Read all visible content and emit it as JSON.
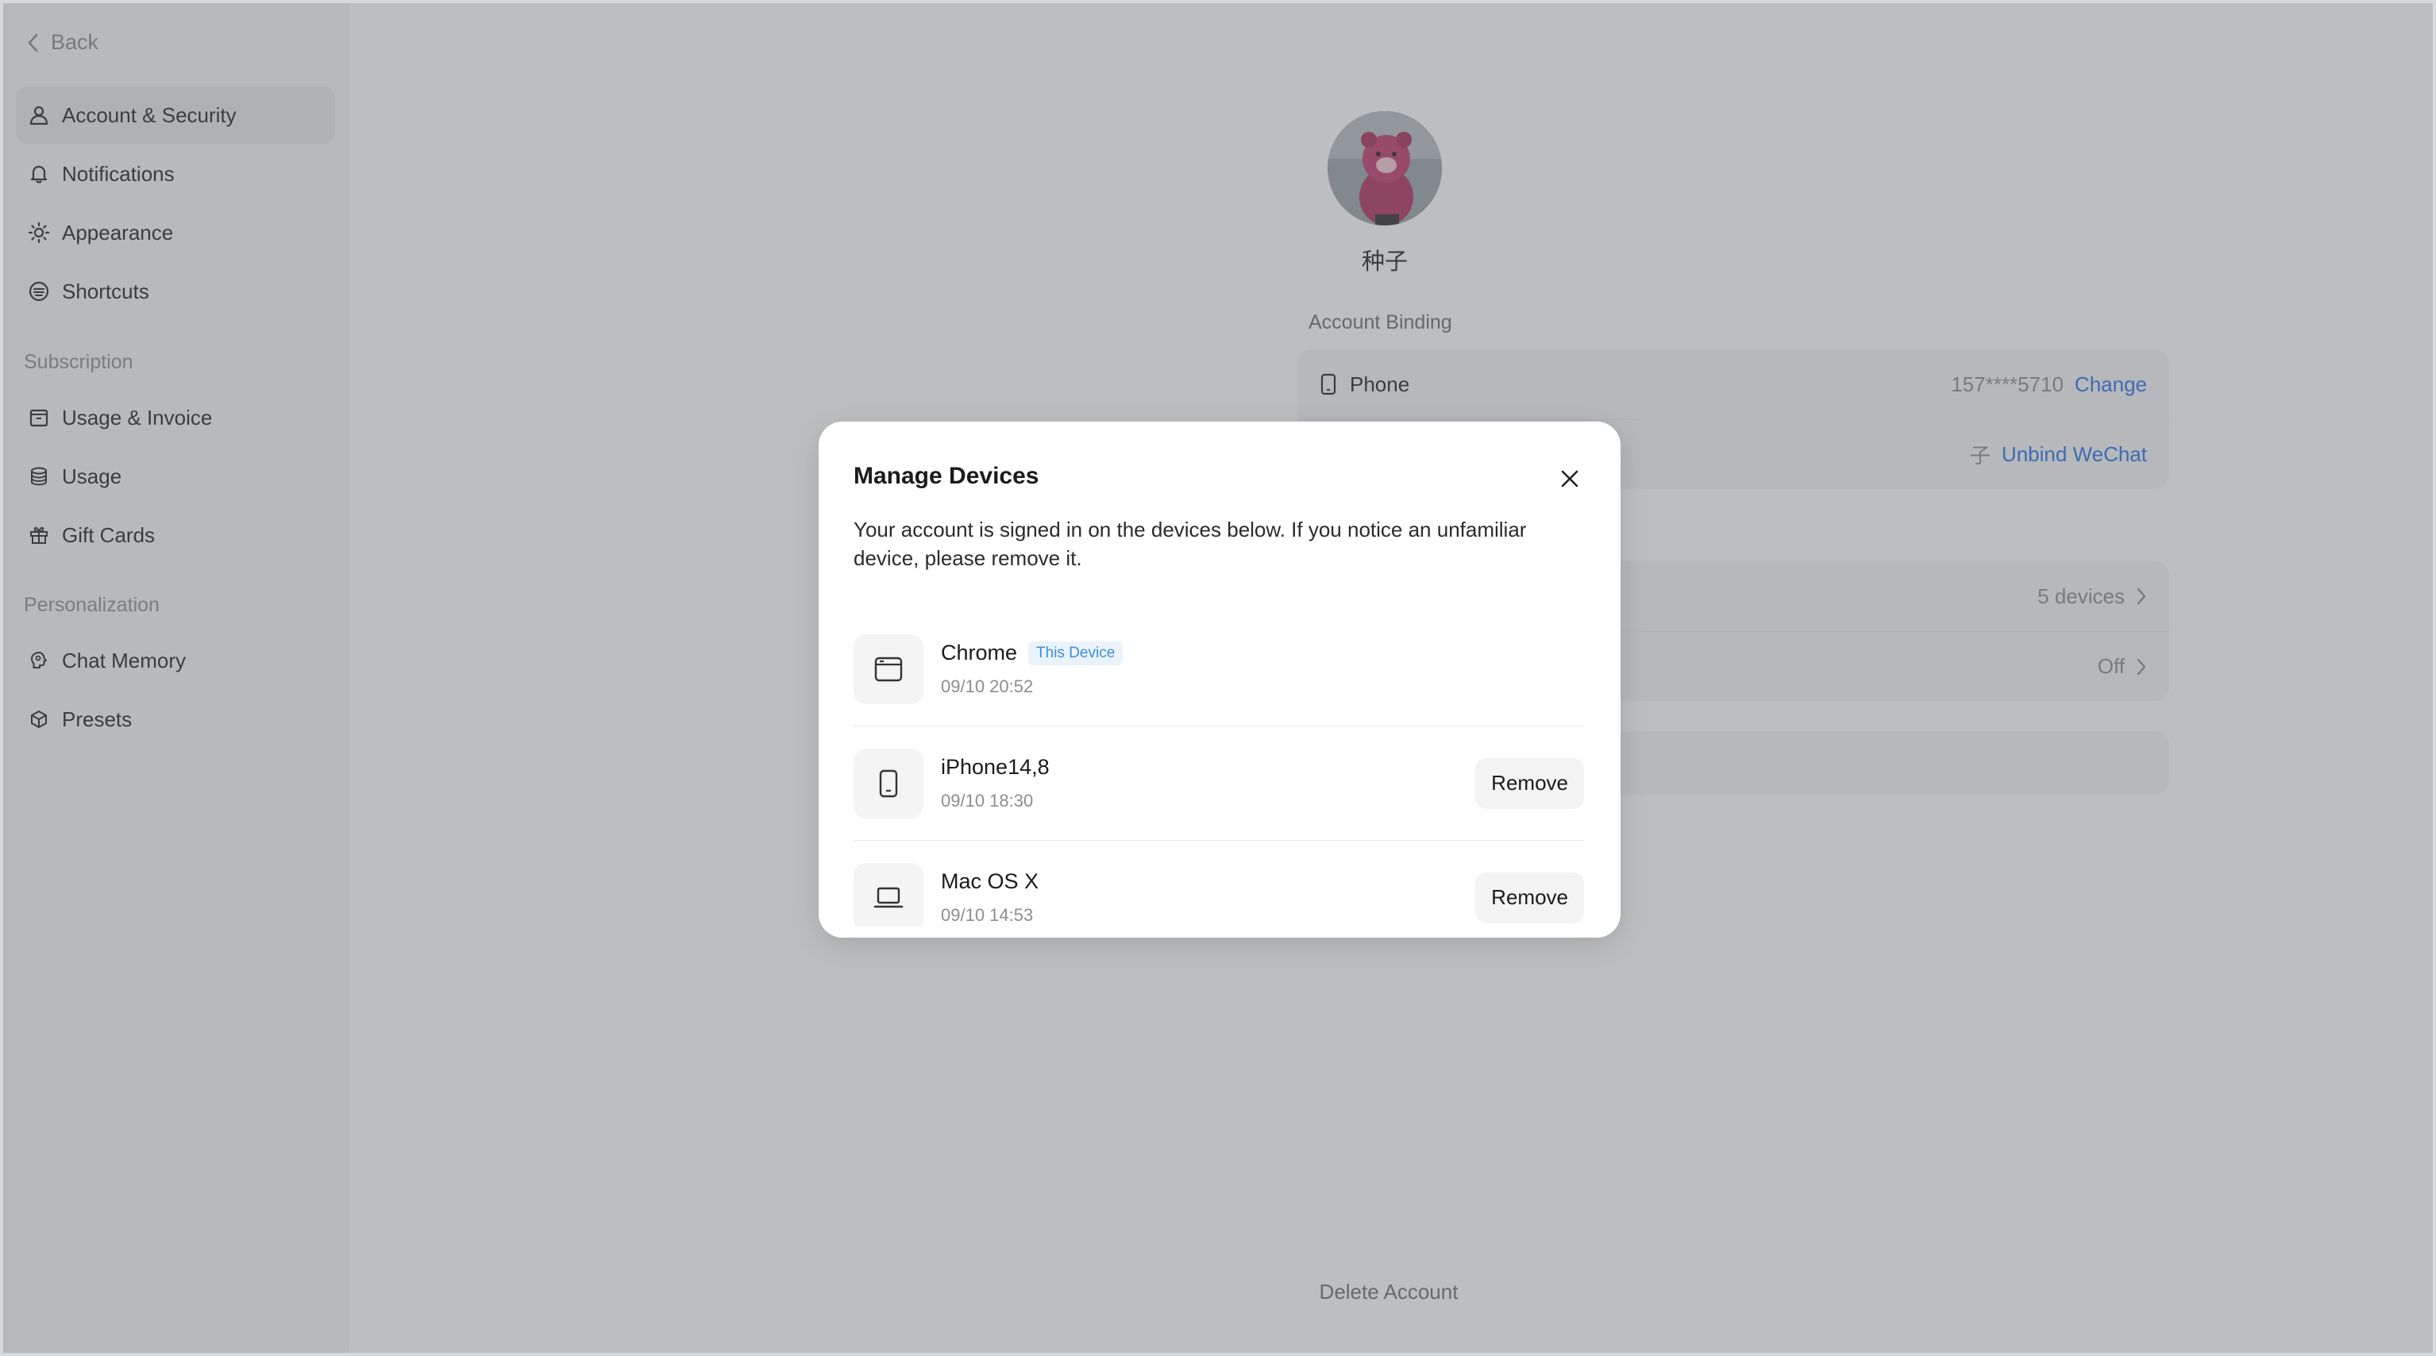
{
  "sidebar": {
    "back_label": "Back",
    "items": [
      {
        "label": "Account & Security",
        "icon": "user-icon"
      },
      {
        "label": "Notifications",
        "icon": "bell-icon"
      },
      {
        "label": "Appearance",
        "icon": "sun-icon"
      },
      {
        "label": "Shortcuts",
        "icon": "keyboard-icon"
      },
      {
        "label": "Usage & Invoice",
        "icon": "invoice-icon"
      },
      {
        "label": "Usage",
        "icon": "database-icon"
      },
      {
        "label": "Gift Cards",
        "icon": "gift-icon"
      },
      {
        "label": "Chat Memory",
        "icon": "brain-icon"
      },
      {
        "label": "Presets",
        "icon": "cube-icon"
      }
    ],
    "sections": {
      "subscription": "Subscription",
      "personalization": "Personalization"
    }
  },
  "profile": {
    "username": "种子"
  },
  "account_binding": {
    "label": "Account Binding",
    "phone": {
      "label": "Phone",
      "value": "157****5710",
      "action": "Change"
    },
    "wechat": {
      "value_partial": "子",
      "action": "Unbind WeChat"
    }
  },
  "devices_card": {
    "devices_value": "5 devices",
    "toggle_value": "Off"
  },
  "footer": {
    "delete_account": "Delete Account"
  },
  "modal": {
    "title": "Manage Devices",
    "description": "Your account is signed in on the devices below. If you notice an unfamiliar device, please remove it.",
    "devices": [
      {
        "name": "Chrome",
        "badge": "This Device",
        "time": "09/10 20:52",
        "icon": "browser-icon"
      },
      {
        "name": "iPhone14,8",
        "time": "09/10 18:30",
        "icon": "phone-icon",
        "action": "Remove"
      },
      {
        "name": "Mac OS X",
        "time": "09/10 14:53",
        "icon": "laptop-icon",
        "action": "Remove"
      }
    ]
  },
  "colors": {
    "accent_link": "#2a6ee8",
    "badge_text": "#3d8fd9",
    "overlay": "rgba(96,100,104,0.42)"
  }
}
